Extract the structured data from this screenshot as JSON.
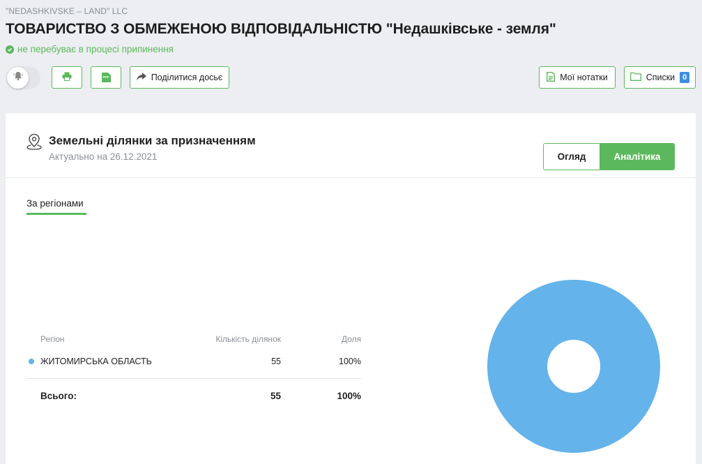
{
  "header": {
    "english_name": "\"NEDASHKIVSKE – LAND\" LLC",
    "title": "ТОВАРИСТВО З ОБМЕЖЕНОЮ ВІДПОВІДАЛЬНІСТЮ \"Недашківське - земля\"",
    "status": "не перебуває в процесі припинення",
    "status_color": "#5cb85c"
  },
  "toolbar": {
    "share_label": "Поділитися досьє",
    "pdf_icon_text": "PDF",
    "notes_label": "Мої нотатки",
    "lists_label": "Списки",
    "lists_count": "0"
  },
  "card": {
    "title": "Земельні ділянки за призначенням",
    "subtitle": "Актуально на 26.12.2021",
    "view_tabs": [
      {
        "label": "Огляд",
        "active": false
      },
      {
        "label": "Аналітика",
        "active": true
      }
    ],
    "sub_tab": "За регіонами"
  },
  "table": {
    "headers": {
      "region": "Регіон",
      "count": "Кількість ділянок",
      "share": "Доля"
    },
    "rows": [
      {
        "region": "ЖИТОМИРСЬКА ОБЛАСТЬ",
        "count": "55",
        "share": "100%",
        "color": "#64b3ea"
      }
    ],
    "total": {
      "label": "Всього:",
      "count": "55",
      "share": "100%"
    }
  },
  "chart_data": {
    "type": "pie",
    "categories": [
      "ЖИТОМИРСЬКА ОБЛАСТЬ"
    ],
    "values": [
      55
    ],
    "colors": [
      "#64b3ea"
    ],
    "donut": true
  },
  "colors": {
    "accent": "#5cb85c",
    "badge": "#3d8ee0",
    "chart_fill": "#64b3ea"
  }
}
